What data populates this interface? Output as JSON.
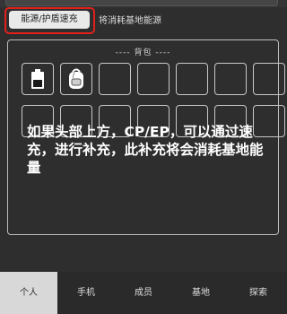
{
  "toolbar": {
    "recharge_button_label": "能源/护盾速充",
    "recharge_hint": "将消耗基地能源"
  },
  "backpack": {
    "title": "---- 背包 ----",
    "slots": [
      {
        "row": 0,
        "col": 0,
        "item": "battery"
      },
      {
        "row": 0,
        "col": 1,
        "item": "backpack"
      },
      {
        "row": 0,
        "col": 2,
        "item": ""
      },
      {
        "row": 0,
        "col": 3,
        "item": ""
      },
      {
        "row": 0,
        "col": 4,
        "item": ""
      },
      {
        "row": 0,
        "col": 5,
        "item": ""
      },
      {
        "row": 0,
        "col": 6,
        "item": ""
      },
      {
        "row": 1,
        "col": 0,
        "item": ""
      },
      {
        "row": 1,
        "col": 1,
        "item": ""
      },
      {
        "row": 1,
        "col": 2,
        "item": ""
      },
      {
        "row": 1,
        "col": 3,
        "item": ""
      },
      {
        "row": 1,
        "col": 4,
        "item": ""
      },
      {
        "row": 1,
        "col": 5,
        "item": ""
      },
      {
        "row": 1,
        "col": 6,
        "item": ""
      }
    ]
  },
  "overlay": {
    "text": "如果头部上方，CP/EP，可以通过速充，进行补充，此补充将会消耗基地能量"
  },
  "nav": {
    "items": [
      {
        "label": "个人",
        "active": true
      },
      {
        "label": "手机",
        "active": false
      },
      {
        "label": "成员",
        "active": false
      },
      {
        "label": "基地",
        "active": false
      },
      {
        "label": "探索",
        "active": false
      }
    ]
  },
  "colors": {
    "highlight": "#e0201b",
    "background": "#2e2e2e"
  }
}
